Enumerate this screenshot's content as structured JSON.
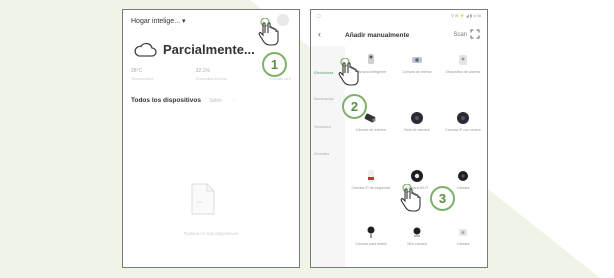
{
  "phone1": {
    "home_title": "Hogar intelige...",
    "home_chevron": "▾",
    "weather_icon": "cloud-icon",
    "weather_text": "Parcialmente...",
    "stats": [
      {
        "value": "28°C",
        "label": "Temperatura"
      },
      {
        "value": "32.1%",
        "label": "Humedad exterior"
      },
      {
        "value": "101",
        "label": "Calidad aire"
      }
    ],
    "devices_title": "Todos los dispositivos",
    "devices_extra": "Salón",
    "devices_more": "···",
    "empty_text": "Todavía no hay dispositivos"
  },
  "phone2": {
    "status_left": "▢",
    "status_right": "⚲ ✉ ⚡ ◢ ▮ 4:08",
    "back": "‹",
    "title": "Añadir manualmente",
    "scan": "Scan",
    "sidebar": [
      {
        "label": "Electricista",
        "active": true
      },
      {
        "label": "Iluminación",
        "active": false
      },
      {
        "label": "Sensores",
        "active": false
      },
      {
        "label": "Grandes",
        "active": false
      }
    ],
    "tiles": [
      {
        "label": "Cámara inteligente",
        "icon": "camera-icon"
      },
      {
        "label": "Cámara de interior",
        "icon": "indoor-camera-icon"
      },
      {
        "label": "Dispositivo de alarma",
        "icon": "alarm-icon"
      },
      {
        "label": "Cámara de exterior",
        "icon": "outdoor-camera-icon"
      },
      {
        "label": "Bola de cámara",
        "icon": "ball-camera-icon"
      },
      {
        "label": "Cámara IP con sensor",
        "icon": "ip-camera-icon"
      },
      {
        "label": "Cámara IP de seguridad",
        "icon": "security-camera-icon"
      },
      {
        "label": "Cámara Wi-Fi",
        "icon": "wifi-camera-icon"
      },
      {
        "label": "Cámara",
        "icon": "mini-camera-icon"
      },
      {
        "label": "Cámara para bebés",
        "icon": "baby-camera-icon"
      },
      {
        "label": "Mini cámara",
        "icon": "round-camera-icon"
      },
      {
        "label": "Cámara",
        "icon": "camera-body-icon"
      }
    ]
  },
  "steps": [
    "1",
    "2",
    "3"
  ],
  "colors": {
    "accent_green": "#7fb069",
    "badge_text": "#5b8f45",
    "background_tint": "#eef5e6"
  }
}
